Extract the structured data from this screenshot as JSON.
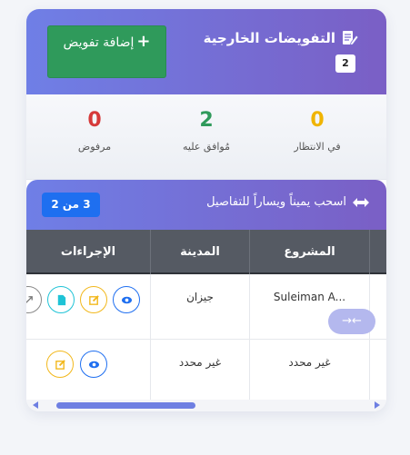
{
  "header": {
    "title": "التفويضات الخارجية",
    "count_badge": "2",
    "add_button_label": "إضافة تفويض",
    "add_button_icon": "+"
  },
  "stats": [
    {
      "value": "0",
      "label": "في الانتظار",
      "color": "#f0b400"
    },
    {
      "value": "2",
      "label": "مُوافق عليه",
      "color": "#2f9a5b"
    },
    {
      "value": "0",
      "label": "مرفوض",
      "color": "#d63a3a"
    }
  ],
  "scroll_bar": {
    "hint": "اسحب يميناً ويساراً للتفاصيل",
    "page_indicator": "3 من 2"
  },
  "table": {
    "headers": {
      "project": "المشروع",
      "city": "المدينة",
      "actions": "الإجراءات"
    },
    "rows": [
      {
        "project": "Suleiman A...",
        "city": "جيزان"
      },
      {
        "project": "غير محدد",
        "city": "غير محدد"
      }
    ]
  },
  "scroll_indicator": "→←",
  "colors": {
    "accent": "#6f7fe6",
    "header_gradient_end": "#7a5fc5",
    "primary": "#1e6ff0"
  }
}
